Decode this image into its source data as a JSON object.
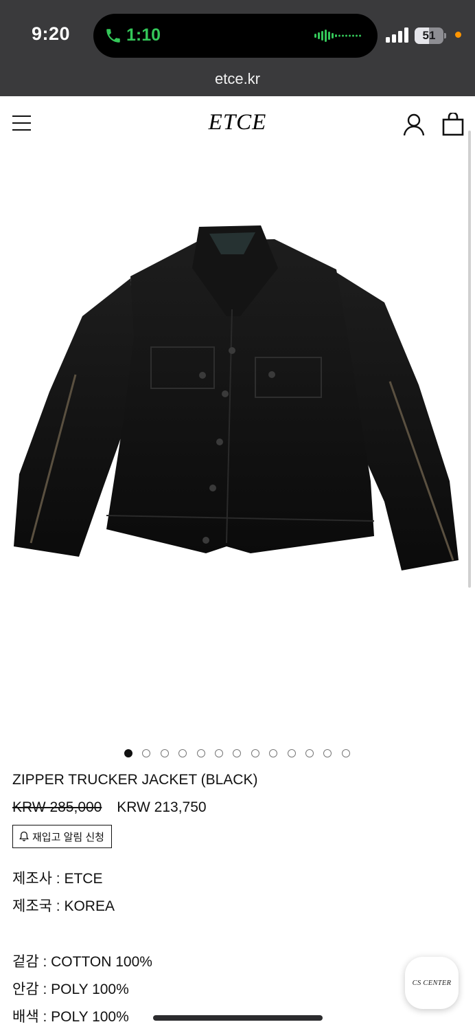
{
  "status_bar": {
    "time": "9:20",
    "call_duration": "1:10",
    "battery_level": "51",
    "battery_fraction": 0.51,
    "call_color": "#34c759",
    "privacy_dot_color": "#ff9500"
  },
  "browser": {
    "url": "etce.kr"
  },
  "header": {
    "logo": "ETCE",
    "icons": [
      "menu-icon",
      "user-icon",
      "shopping-bag-icon"
    ]
  },
  "gallery": {
    "image_count": 13,
    "active_index": 0
  },
  "product": {
    "title": "ZIPPER TRUCKER JACKET (BLACK)",
    "original_price": "KRW 285,000",
    "sale_price": "KRW 213,750",
    "restock_button": "재입고 알림 신청",
    "specs": [
      {
        "text": "제조사 : ETCE"
      },
      {
        "text": "제조국 : KOREA"
      },
      {
        "text": "겉감 : COTTON 100%"
      },
      {
        "text": "안감 : POLY 100%"
      },
      {
        "text": "배색 : POLY 100%"
      }
    ]
  },
  "cs_button": {
    "label": "CS CENTER"
  }
}
